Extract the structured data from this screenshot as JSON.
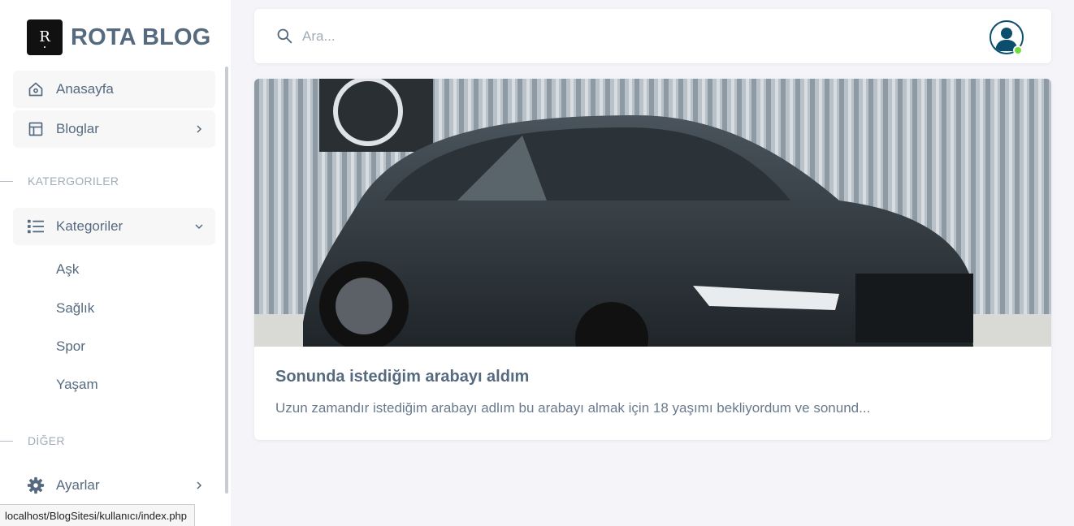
{
  "brand": {
    "name": "ROTA BLOG",
    "logo_letter": "R"
  },
  "sidebar": {
    "menu": [
      {
        "label": "Anasayfa",
        "icon": "home-icon"
      },
      {
        "label": "Bloglar",
        "icon": "layout-icon"
      }
    ],
    "section_categories": "KATERGORILER",
    "categories_menu": {
      "label": "Kategoriler",
      "icon": "list-icon"
    },
    "categories": [
      "Aşk",
      "Sağlık",
      "Spor",
      "Yaşam"
    ],
    "section_other": "DİĞER",
    "settings": {
      "label": "Ayarlar",
      "icon": "gear-icon"
    }
  },
  "search": {
    "placeholder": "Ara..."
  },
  "post": {
    "title": "Sonunda istediğim arabayı aldım",
    "excerpt": "Uzun zamandır istediğim arabayı adlım bu arabayı almak için 18 yaşımı bekliyordum ve sonund..."
  },
  "status_url": "localhost/BlogSitesi/kullanıcı/index.php",
  "colors": {
    "text": "#566a7f",
    "muted": "#a1acb8",
    "background": "#f5f5f9",
    "online": "#71dd37",
    "avatar_ring": "#0b4f6c"
  }
}
